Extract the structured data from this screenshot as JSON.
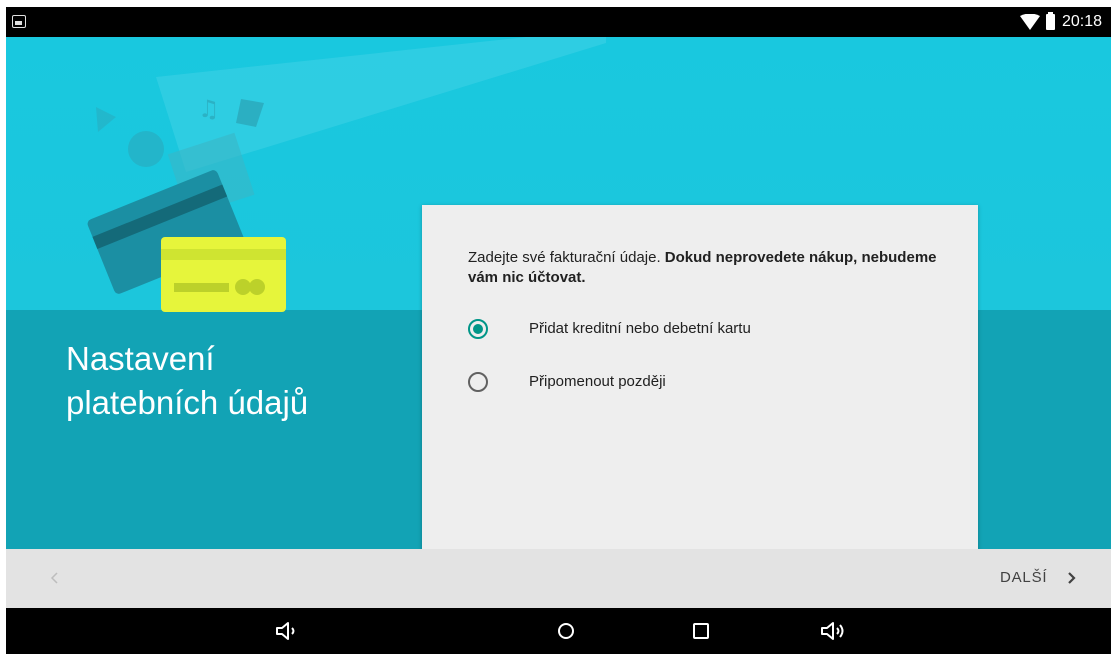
{
  "status_bar": {
    "time": "20:18",
    "icons": [
      "gallery-notification-icon",
      "wifi-icon",
      "battery-icon"
    ]
  },
  "page": {
    "title_line1": "Nastavení",
    "title_line2": "platebních údajů"
  },
  "card": {
    "intro_normal": "Zadejte své fakturační údaje. ",
    "intro_bold": "Dokud neprovedete nákup, nebudeme vám nic účtovat.",
    "options": [
      {
        "label": "Přidat kreditní nebo debetní kartu",
        "selected": true
      },
      {
        "label": "Připomenout později",
        "selected": false
      }
    ]
  },
  "footer": {
    "back_icon": "chevron-left-icon",
    "next_label": "DALŠÍ",
    "next_icon": "chevron-right-icon"
  },
  "nav_bar": {
    "buttons": [
      "volume-down-icon",
      "home-icon",
      "recents-icon",
      "volume-up-icon"
    ]
  },
  "colors": {
    "accent": "#009688",
    "hero": "#00bcd4",
    "hero_dark": "#12a3b5",
    "card_bg": "#eeeeee",
    "footer_bg": "#e3e3e3"
  }
}
